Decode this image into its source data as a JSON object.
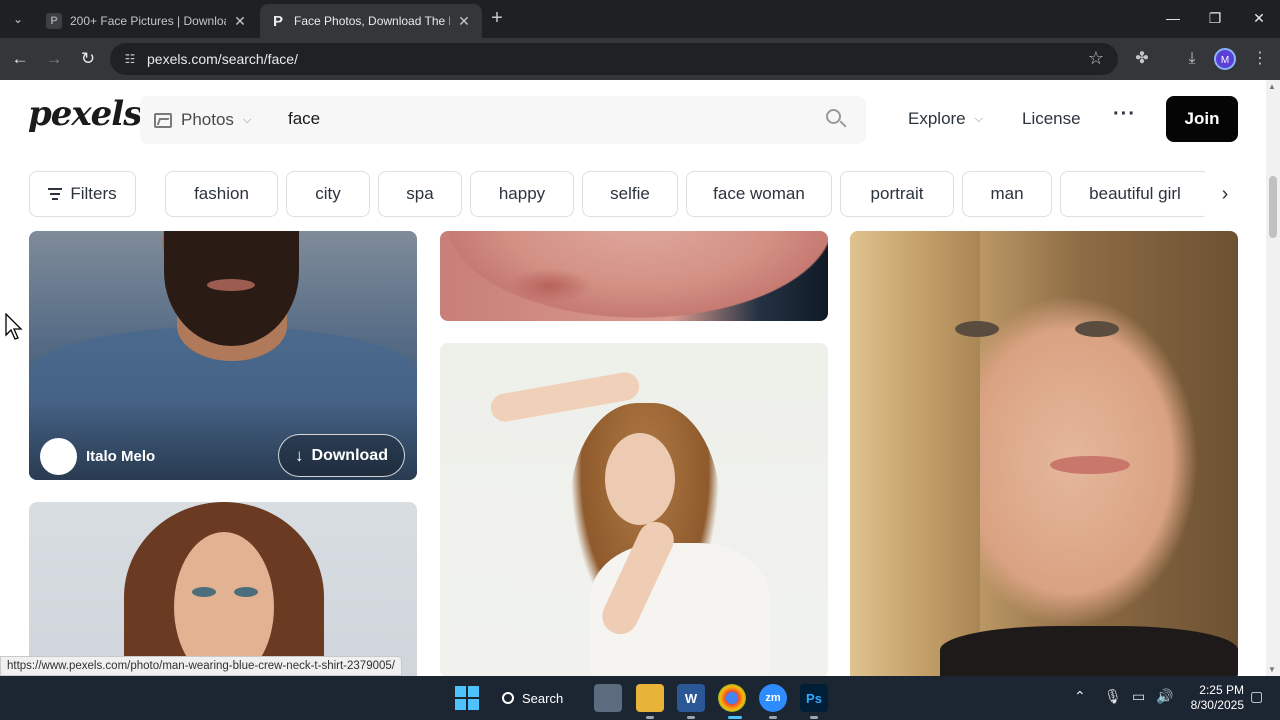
{
  "browser": {
    "tabs": [
      {
        "title": "200+ Face Pictures | Download",
        "favicon": "P"
      },
      {
        "title": "Face Photos, Download The BE",
        "favicon": "P"
      }
    ],
    "url": "pexels.com/search/face/",
    "profile_initial": "M"
  },
  "site": {
    "logo": "pexels",
    "search": {
      "type_label": "Photos",
      "query": "face"
    },
    "nav": {
      "explore": "Explore",
      "license": "License",
      "more": "···",
      "join": "Join"
    },
    "filters_label": "Filters",
    "tags": [
      "fashion",
      "city",
      "spa",
      "happy",
      "selfie",
      "face woman",
      "portrait",
      "man",
      "beautiful girl"
    ]
  },
  "photos": {
    "first": {
      "author": "Italo Melo",
      "download_label": "Download"
    }
  },
  "status_url": "https://www.pexels.com/photo/man-wearing-blue-crew-neck-t-shirt-2379005/",
  "taskbar": {
    "search_label": "Search",
    "time": "2:25 PM",
    "date": "8/30/2025"
  },
  "colors": {
    "join_bg": "#050505",
    "browser_frame": "#1f2023",
    "taskbar": "#1c2532"
  }
}
